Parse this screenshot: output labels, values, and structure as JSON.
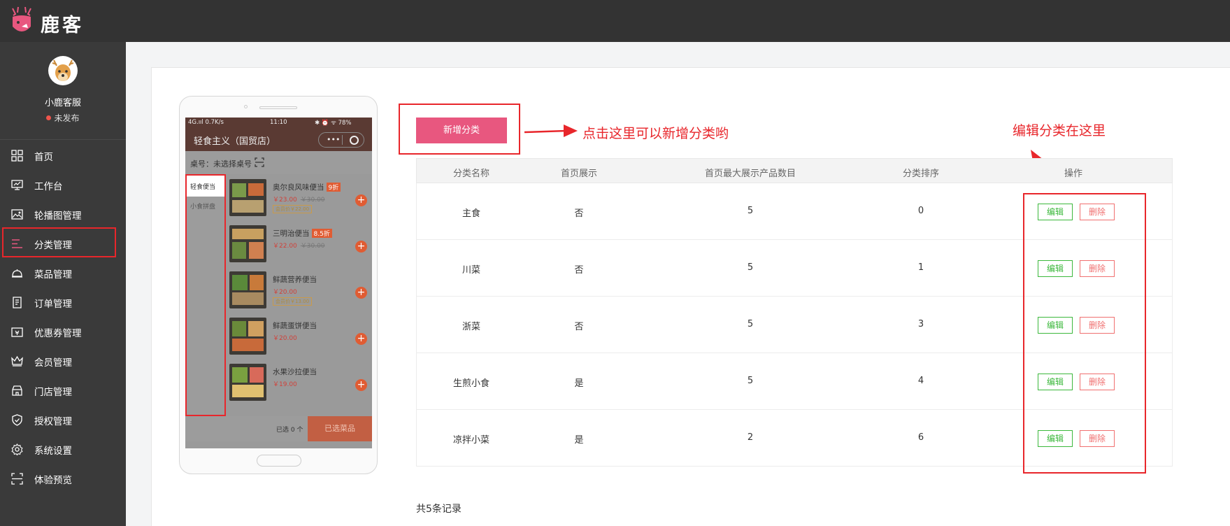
{
  "header": {
    "brand": "鹿客"
  },
  "sidebar": {
    "user_name": "小鹿客服",
    "status": "未发布",
    "items": [
      {
        "label": "首页",
        "icon": "grid-icon"
      },
      {
        "label": "工作台",
        "icon": "monitor-icon"
      },
      {
        "label": "轮播图管理",
        "icon": "image-icon"
      },
      {
        "label": "分类管理",
        "icon": "list-icon"
      },
      {
        "label": "菜品管理",
        "icon": "dish-cover-icon"
      },
      {
        "label": "订单管理",
        "icon": "document-icon"
      },
      {
        "label": "优惠券管理",
        "icon": "coupon-icon"
      },
      {
        "label": "会员管理",
        "icon": "crown-icon"
      },
      {
        "label": "门店管理",
        "icon": "store-icon"
      },
      {
        "label": "授权管理",
        "icon": "shield-icon"
      },
      {
        "label": "系统设置",
        "icon": "gear-icon"
      },
      {
        "label": "体验预览",
        "icon": "scan-icon"
      }
    ]
  },
  "phone": {
    "status_left": "4G.ııl 0.7K/s",
    "status_time": "11:10",
    "status_right": "✱ ⏰ ᯤ 78%",
    "store_title": "轻食主义（国贸店）",
    "table_text": "桌号：未选择桌号",
    "categories": [
      "轻食便当",
      "小食拼盘"
    ],
    "products": [
      {
        "name": "奥尔良风味便当",
        "discount": "9折",
        "price": "￥23.00",
        "orig": "￥30.00",
        "member": "会员价￥22.00"
      },
      {
        "name": "三明治便当",
        "discount": "8.5折",
        "price": "￥22.00",
        "orig": "￥30.00",
        "member": ""
      },
      {
        "name": "鲜蔬营养便当",
        "discount": "",
        "price": "￥20.00",
        "orig": "",
        "member": "会员价￥13.00"
      },
      {
        "name": "鲜蔬蛋饼便当",
        "discount": "",
        "price": "￥20.00",
        "orig": "",
        "member": ""
      },
      {
        "name": "水果沙拉便当",
        "discount": "",
        "price": "￥19.00",
        "orig": "",
        "member": ""
      }
    ],
    "cart_count": "已选 0 个",
    "cart_button": "已选菜品"
  },
  "toolbar": {
    "add_category_label": "新增分类"
  },
  "annotations": {
    "add_hint": "点击这里可以新增分类哟",
    "edit_hint": "编辑分类在这里"
  },
  "table": {
    "headers": [
      "分类名称",
      "首页展示",
      "首页最大展示产品数目",
      "分类排序",
      "操作"
    ],
    "rows": [
      {
        "name": "主食",
        "show": "否",
        "max": "5",
        "sort": "0"
      },
      {
        "name": "川菜",
        "show": "否",
        "max": "5",
        "sort": "1"
      },
      {
        "name": "浙菜",
        "show": "否",
        "max": "5",
        "sort": "3"
      },
      {
        "name": "生煎小食",
        "show": "是",
        "max": "5",
        "sort": "4"
      },
      {
        "name": "凉拌小菜",
        "show": "是",
        "max": "2",
        "sort": "6"
      }
    ],
    "edit_label": "编辑",
    "delete_label": "删除"
  },
  "footer": {
    "total": "共5条记录"
  },
  "colors": {
    "accent": "#e8577f",
    "highlight": "#e8262b",
    "edit": "#3cb83c",
    "delete": "#f07070"
  }
}
